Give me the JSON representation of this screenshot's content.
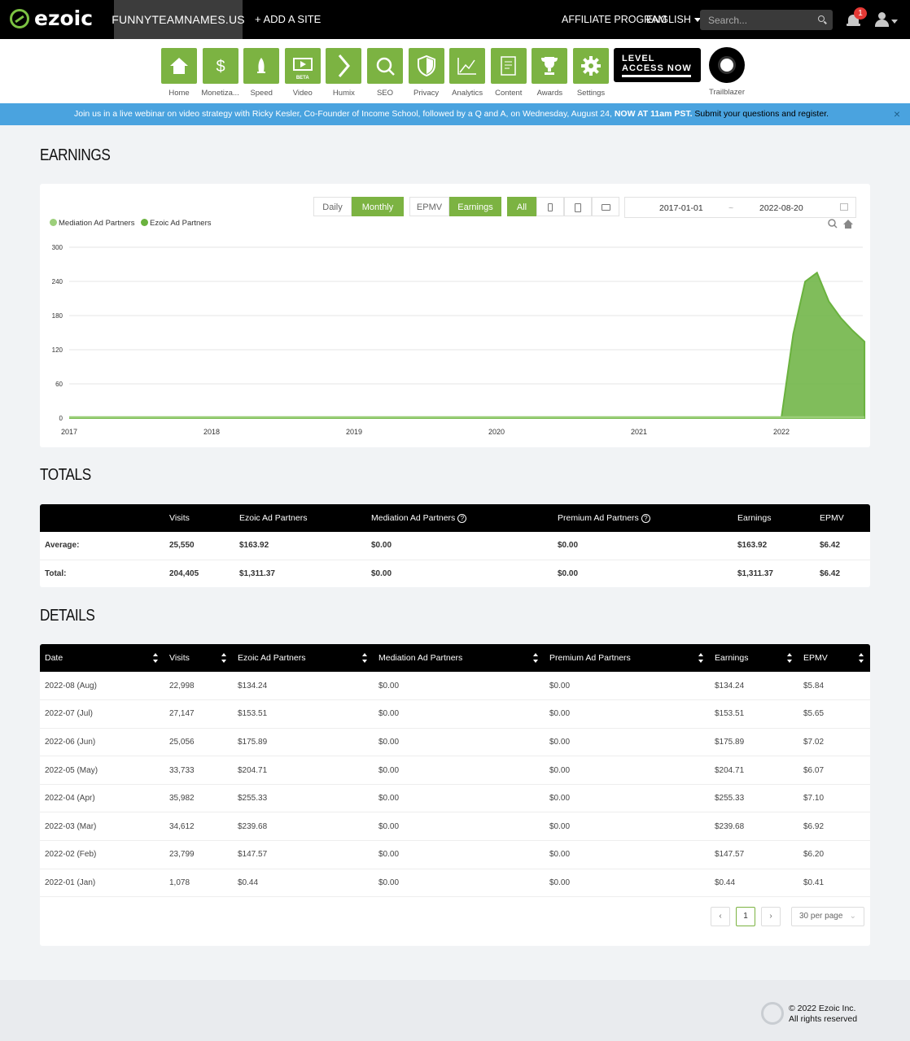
{
  "header": {
    "logo": "ezoic",
    "site": "FUNNYTEAMNAMES.US",
    "add_site": "+ ADD A SITE",
    "affiliate": "AFFILIATE PROGRAM",
    "language": "ENGLISH",
    "search_placeholder": "Search...",
    "notification_count": "1"
  },
  "nav": {
    "items": [
      {
        "label": "Home",
        "icon": "home-icon"
      },
      {
        "label": "Monetiza...",
        "icon": "dollar-icon"
      },
      {
        "label": "Speed",
        "icon": "rocket-icon"
      },
      {
        "label": "Video",
        "icon": "video-icon",
        "badge": "BETA"
      },
      {
        "label": "Humix",
        "icon": "chevron-right-icon"
      },
      {
        "label": "SEO",
        "icon": "magnifier-icon"
      },
      {
        "label": "Privacy",
        "icon": "shield-icon"
      },
      {
        "label": "Analytics",
        "icon": "line-chart-icon"
      },
      {
        "label": "Content",
        "icon": "document-icon"
      },
      {
        "label": "Awards",
        "icon": "trophy-icon"
      },
      {
        "label": "Settings",
        "icon": "gear-icon"
      }
    ],
    "level_line1": "LEVEL",
    "level_line2": "ACCESS NOW",
    "trailblazer": "Trailblazer"
  },
  "banner": {
    "text": "Join us in a live webinar on video strategy with Ricky Kesler, Co-Founder of Income School, followed by a Q and A, on Wednesday, August 24, ",
    "bold": "NOW AT 11am PST.",
    "link": " Submit your questions and register.",
    "close": "×"
  },
  "earnings": {
    "title": "EARNINGS",
    "buttons": {
      "daily": "Daily",
      "monthly": "Monthly",
      "epmv": "EPMV",
      "earnings": "Earnings",
      "all": "All"
    },
    "date_from": "2017-01-01",
    "date_sep": "~",
    "date_to": "2022-08-20"
  },
  "chart_data": {
    "type": "area",
    "legend": [
      "Mediation Ad Partners",
      "Ezoic Ad Partners"
    ],
    "colors": {
      "mediation": "#9ccf7a",
      "ezoic": "#6ab23e"
    },
    "x_ticks": [
      "2017",
      "2018",
      "2019",
      "2020",
      "2021",
      "2022"
    ],
    "y_ticks": [
      "0",
      "60",
      "120",
      "180",
      "240",
      "300"
    ],
    "ylim": [
      0,
      300
    ],
    "series": [
      {
        "name": "Ezoic Ad Partners",
        "points": [
          [
            "2017-01",
            0
          ],
          [
            "2021-12",
            0
          ],
          [
            "2022-01",
            0.44
          ],
          [
            "2022-02",
            147.57
          ],
          [
            "2022-03",
            239.68
          ],
          [
            "2022-04",
            255.33
          ],
          [
            "2022-05",
            204.71
          ],
          [
            "2022-06",
            175.89
          ],
          [
            "2022-07",
            153.51
          ],
          [
            "2022-08",
            134.24
          ]
        ]
      },
      {
        "name": "Mediation Ad Partners",
        "points": [
          [
            "2017-01",
            0
          ],
          [
            "2022-08",
            0
          ]
        ]
      }
    ]
  },
  "totals": {
    "title": "TOTALS",
    "headers": [
      "",
      "Visits",
      "Ezoic Ad Partners",
      "Mediation Ad Partners",
      "Premium Ad Partners",
      "Earnings",
      "EPMV"
    ],
    "rows": [
      [
        "Average:",
        "25,550",
        "$163.92",
        "$0.00",
        "$0.00",
        "$163.92",
        "$6.42"
      ],
      [
        "Total:",
        "204,405",
        "$1,311.37",
        "$0.00",
        "$0.00",
        "$1,311.37",
        "$6.42"
      ]
    ]
  },
  "details": {
    "title": "DETAILS",
    "headers": [
      "Date",
      "Visits",
      "Ezoic Ad Partners",
      "Mediation Ad Partners",
      "Premium Ad Partners",
      "Earnings",
      "EPMV"
    ],
    "rows": [
      [
        "2022-08 (Aug)",
        "22,998",
        "$134.24",
        "$0.00",
        "$0.00",
        "$134.24",
        "$5.84"
      ],
      [
        "2022-07 (Jul)",
        "27,147",
        "$153.51",
        "$0.00",
        "$0.00",
        "$153.51",
        "$5.65"
      ],
      [
        "2022-06 (Jun)",
        "25,056",
        "$175.89",
        "$0.00",
        "$0.00",
        "$175.89",
        "$7.02"
      ],
      [
        "2022-05 (May)",
        "33,733",
        "$204.71",
        "$0.00",
        "$0.00",
        "$204.71",
        "$6.07"
      ],
      [
        "2022-04 (Apr)",
        "35,982",
        "$255.33",
        "$0.00",
        "$0.00",
        "$255.33",
        "$7.10"
      ],
      [
        "2022-03 (Mar)",
        "34,612",
        "$239.68",
        "$0.00",
        "$0.00",
        "$239.68",
        "$6.92"
      ],
      [
        "2022-02 (Feb)",
        "23,799",
        "$147.57",
        "$0.00",
        "$0.00",
        "$147.57",
        "$6.20"
      ],
      [
        "2022-01 (Jan)",
        "1,078",
        "$0.44",
        "$0.00",
        "$0.00",
        "$0.44",
        "$0.41"
      ]
    ],
    "page": "1",
    "per_page": "30 per page"
  },
  "footer": {
    "copyright": "© 2022 Ezoic Inc.",
    "rights": "All rights reserved"
  }
}
